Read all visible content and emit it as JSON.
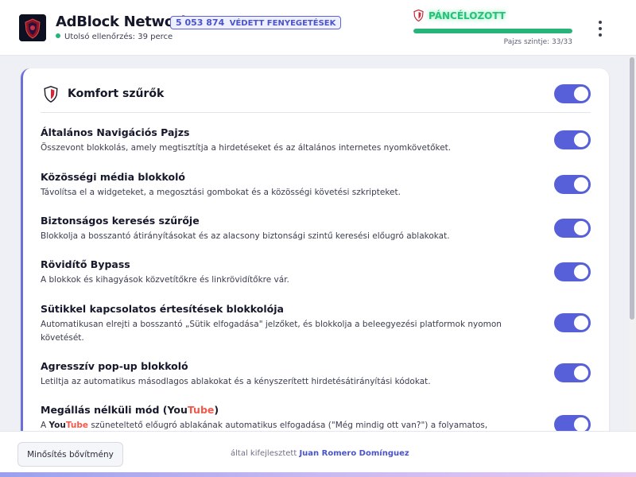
{
  "header": {
    "app_title": "AdBlock Network",
    "threats_count": "5 053 874",
    "threats_label": "VÉDETT FENYEGETÉSEK",
    "last_check": "Utolsó ellenőrzés: 39 perce",
    "armor_status": "PÁNCÉLOZOTT",
    "shield_level_label": "Pajzs szintje: 33/33",
    "shield_progress": 1.0,
    "menu_icon": "more-vertical-icon"
  },
  "section": {
    "title": "Komfort szűrők",
    "enabled": true
  },
  "settings": [
    {
      "title": "Általános Navigációs Pajzs",
      "description": "Összevont blokkolás, amely megtisztítja a hirdetéseket és az általános internetes nyomkövetőket.",
      "enabled": true
    },
    {
      "title": "Közösségi média blokkoló",
      "description": "Távolítsa el a widgeteket, a megosztási gombokat és a közösségi követési szkripteket.",
      "enabled": true
    },
    {
      "title": "Biztonságos keresés szűrője",
      "description": "Blokkolja a bosszantó átirányításokat és az alacsony biztonsági szintű keresési előugró ablakokat.",
      "enabled": true
    },
    {
      "title": "Rövidítő Bypass",
      "description": "A blokkok és kihagyások közvetítőkre és linkrövidítőkre vár.",
      "enabled": true
    },
    {
      "title": "Sütikkel kapcsolatos értesítések blokkolója",
      "description": "Automatikusan elrejti a bosszantó „Sütik elfogadása\" jelzőket, és blokkolja a beleegyezési platformok nyomon követését.",
      "enabled": true
    },
    {
      "title": "Agresszív pop-up blokkoló",
      "description": "Letiltja az automatikus másodlagos ablakokat és a kényszerített hirdetésátirányítási kódokat.",
      "enabled": true
    },
    {
      "title_prefix": "Megállás nélküli mód (",
      "title_you": "You",
      "title_tube": "Tube",
      "title_suffix": ")",
      "desc_prefix": "A ",
      "desc_you": "You",
      "desc_tube": "Tube",
      "desc_suffix": " szüneteltető előugró ablakának automatikus elfogadása (\"Még mindig ott van?\") a folyamatos,",
      "enabled": true
    }
  ],
  "footer": {
    "rate_button": "Minősítés bővítmény",
    "credit_prefix": "által kifejlesztett",
    "credit_author": "Juan Romero Domínguez"
  },
  "colors": {
    "accent": "#5760d9",
    "armor_green": "#27c27a",
    "youtube_red": "#f2594b"
  }
}
